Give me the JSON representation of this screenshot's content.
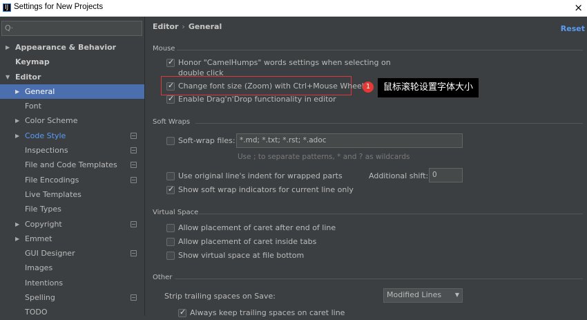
{
  "window": {
    "title": "Settings for New Projects",
    "close": "×",
    "icon_letter": "IJ"
  },
  "search": {
    "glyph": "Q·",
    "placeholder": ""
  },
  "tree": [
    {
      "label": "Appearance & Behavior",
      "bold": true,
      "arrow": "▶"
    },
    {
      "label": "Keymap",
      "bold": true,
      "arrow": ""
    },
    {
      "label": "Editor",
      "bold": true,
      "arrow": "▼"
    },
    {
      "label": "General",
      "arrow": "▶",
      "selected": true
    },
    {
      "label": "Font",
      "arrow": ""
    },
    {
      "label": "Color Scheme",
      "arrow": "▶"
    },
    {
      "label": "Code Style",
      "arrow": "▶",
      "blue": true,
      "project": true
    },
    {
      "label": "Inspections",
      "arrow": "",
      "project": true
    },
    {
      "label": "File and Code Templates",
      "arrow": "",
      "project": true
    },
    {
      "label": "File Encodings",
      "arrow": "",
      "project": true
    },
    {
      "label": "Live Templates",
      "arrow": ""
    },
    {
      "label": "File Types",
      "arrow": ""
    },
    {
      "label": "Copyright",
      "arrow": "▶",
      "project": true
    },
    {
      "label": "Emmet",
      "arrow": "▶"
    },
    {
      "label": "GUI Designer",
      "arrow": "",
      "project": true
    },
    {
      "label": "Images",
      "arrow": ""
    },
    {
      "label": "Intentions",
      "arrow": ""
    },
    {
      "label": "Spelling",
      "arrow": "",
      "project": true
    },
    {
      "label": "TODO",
      "arrow": ""
    }
  ],
  "breadcrumb": {
    "parent": "Editor",
    "sep": "›",
    "current": "General"
  },
  "reset": "Reset",
  "sections": {
    "mouse": "Mouse",
    "soft_wraps": "Soft Wraps",
    "virtual_space": "Virtual Space",
    "other": "Other"
  },
  "options": {
    "camel_line1": "Honor \"CamelHumps\" words settings when selecting on",
    "camel_line2": "double click",
    "zoom": "Change font size (Zoom) with Ctrl+Mouse Wheel",
    "dragdrop": "Enable Drag'n'Drop functionality in editor",
    "softwrap_files": "Soft-wrap files:",
    "softwrap_value": "*.md; *.txt; *.rst; *.adoc",
    "softwrap_hint": "Use ; to separate patterns, * and ? as wildcards",
    "original_indent": "Use original line's indent for wrapped parts",
    "additional_shift": "Additional shift:",
    "additional_shift_value": "0",
    "show_indicators": "Show soft wrap indicators for current line only",
    "caret_after_end": "Allow placement of caret after end of line",
    "caret_inside_tabs": "Allow placement of caret inside tabs",
    "virtual_space_bottom": "Show virtual space at file bottom",
    "strip_trailing": "Strip trailing spaces on Save:",
    "strip_value": "Modified Lines",
    "keep_trailing": "Always keep trailing spaces on caret line"
  },
  "annotation": {
    "number": "1",
    "text": "鼠标滚轮设置字体大小",
    "color": "#e53935"
  }
}
